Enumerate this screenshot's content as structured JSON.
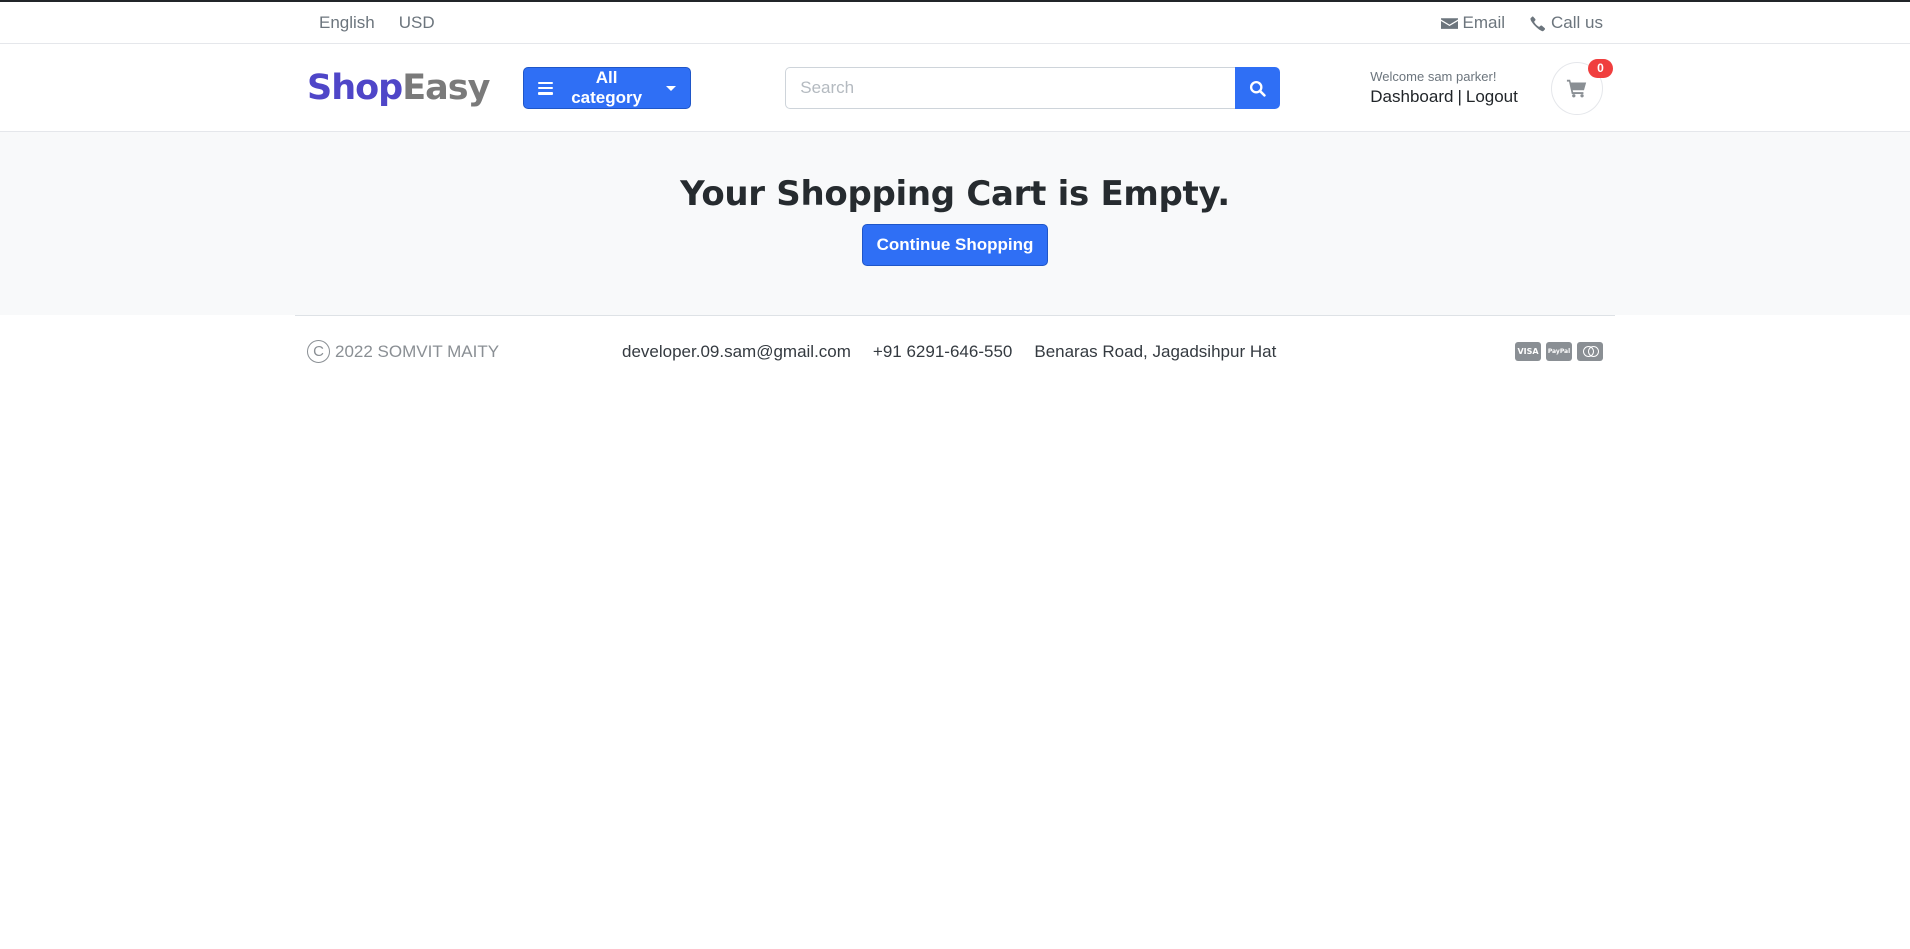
{
  "topbar": {
    "language": "English",
    "currency": "USD",
    "email_label": "Email",
    "call_label": "Call us"
  },
  "header": {
    "logo_part1": "Shop",
    "logo_part2": "Easy",
    "category_button": "All category",
    "search_placeholder": "Search",
    "welcome_text": "Welcome sam parker!",
    "dashboard_link": "Dashboard",
    "separator": "|",
    "logout_link": "Logout",
    "cart_count": "0"
  },
  "main": {
    "heading": "Your Shopping Cart is Empty.",
    "continue_button": "Continue Shopping"
  },
  "footer": {
    "copyright": "2022 SOMVIT MAITY",
    "copyright_symbol": "C",
    "email": "developer.09.sam@gmail.com",
    "phone": "+91 6291-646-550",
    "address": "Benaras Road, Jagadsihpur Hat",
    "payments": [
      "VISA",
      "PayPal",
      "mastercard"
    ]
  },
  "colors": {
    "primary": "#2f6ff5",
    "logo_shop": "#4f46c8",
    "logo_easy": "#7a7a7a",
    "badge": "#f03e3e"
  }
}
